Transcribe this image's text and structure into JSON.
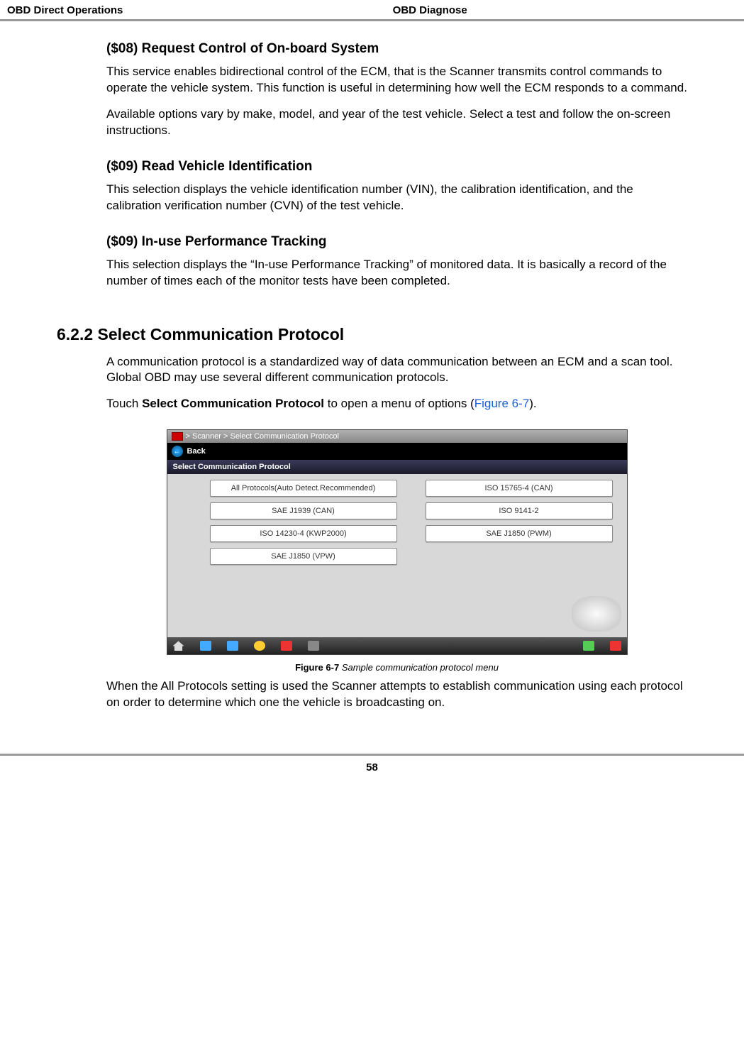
{
  "header": {
    "left": "OBD Direct Operations",
    "right": "OBD Diagnose"
  },
  "sections": {
    "s08": {
      "heading": "($08) Request Control of On-board System",
      "p1": "This service enables bidirectional control of the ECM, that is the Scanner transmits control commands to operate the vehicle system. This function is useful in determining how well the ECM responds to a command.",
      "p2": "Available options vary by make, model, and year of the test vehicle. Select a test and follow the on-screen instructions."
    },
    "s09a": {
      "heading": "($09) Read Vehicle Identification",
      "p1": "This selection displays the vehicle identification number (VIN), the calibration identification, and the calibration verification number (CVN) of the test vehicle."
    },
    "s09b": {
      "heading": "($09) In-use Performance Tracking",
      "p1": "This selection displays the “In-use Performance Tracking” of monitored data. It is basically a record of the number of times each of the monitor tests have been completed."
    },
    "s622": {
      "heading": "6.2.2  Select Communication Protocol",
      "p1": "A communication protocol is a standardized way of data communication between an ECM and a scan tool. Global OBD may use several different communication protocols.",
      "p2a": "Touch ",
      "p2b": "Select Communication Protocol",
      "p2c": " to open a menu of options (",
      "p2link": "Figure 6-7",
      "p2d": ").",
      "p3": "When the All Protocols setting is used the Scanner attempts to establish communication using each protocol on order to determine which one the vehicle is broadcasting on."
    }
  },
  "screenshot": {
    "breadcrumb": "> Scanner  > Select Communication Protocol",
    "back": "Back",
    "subtitle": "Select Communication Protocol",
    "buttons": [
      "All Protocols(Auto Detect.Recommended)",
      "ISO 15765-4 (CAN)",
      "SAE J1939 (CAN)",
      "ISO 9141-2",
      "ISO 14230-4 (KWP2000)",
      "SAE J1850 (PWM)",
      "SAE J1850 (VPW)"
    ]
  },
  "figure": {
    "num": "Figure 6-7 ",
    "title": "Sample communication protocol menu"
  },
  "footer": {
    "page": "58"
  }
}
